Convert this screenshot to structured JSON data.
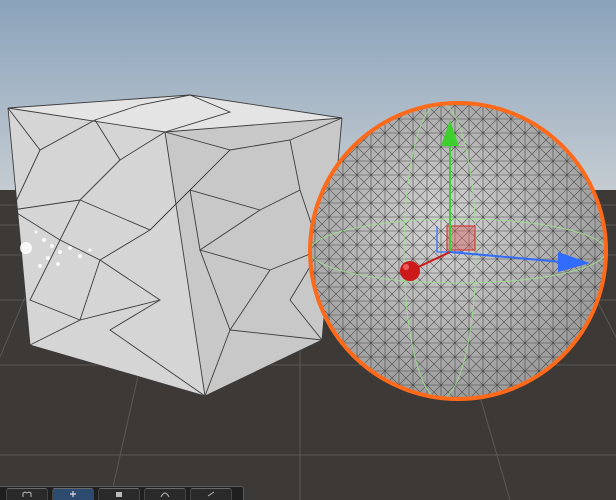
{
  "viewport": {
    "title": "",
    "colors": {
      "sky_top": "#8fa6bc",
      "sky_horizon": "#c5ccd1",
      "ground": "#3d3936",
      "grid_line": "#5b5754",
      "cube_face_front": "#d6d6d6",
      "cube_face_side": "#c6c6c6",
      "cube_face_top": "#e6e6e6",
      "wire": "#3a3a3a",
      "sphere_fill": "#bdbdbd",
      "selection_outline": "#ff6a1a",
      "axis_x": "#2f6cff",
      "axis_y": "#3ecf2e",
      "axis_z": "#cc1a1a",
      "plane_handle": "#d46060"
    }
  },
  "objects": [
    {
      "name": "cube",
      "selected": false
    },
    {
      "name": "sphere",
      "selected": true
    }
  ],
  "gizmo": {
    "type": "move",
    "axes": [
      "x-axis-handle",
      "y-axis-handle",
      "z-axis-handle"
    ]
  },
  "toolbar": {
    "tools": [
      {
        "icon": "hand-icon",
        "active": false
      },
      {
        "icon": "move-icon",
        "active": true
      },
      {
        "icon": "rotate-icon",
        "active": false
      },
      {
        "icon": "scale-icon",
        "active": false
      },
      {
        "icon": "rect-icon",
        "active": false
      }
    ]
  }
}
